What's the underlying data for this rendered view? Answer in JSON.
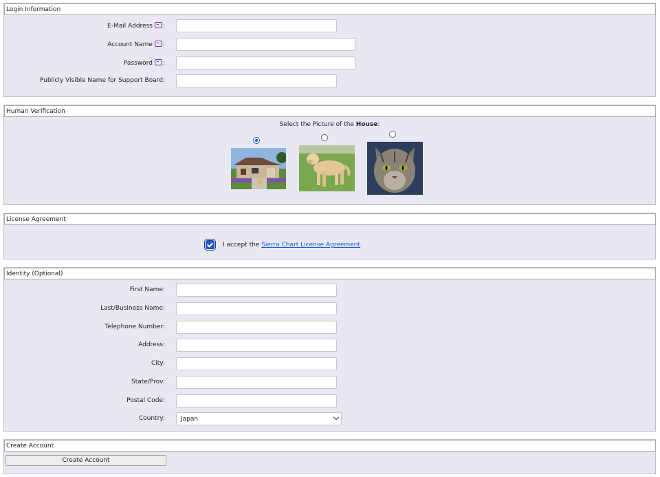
{
  "login": {
    "legend": "Login Information",
    "email_label": "E-Mail Address",
    "account_label": "Account Name",
    "password_label": "Password",
    "public_name_label": "Publicly Visible Name for Support Board:",
    "colon": ":",
    "email_value": "",
    "account_value": "",
    "password_value": "",
    "public_name_value": ""
  },
  "verification": {
    "legend": "Human Verification",
    "prompt_prefix": "Select the Picture of the ",
    "prompt_bold": "House",
    "prompt_suffix": ":",
    "options": [
      "house",
      "dog",
      "cat"
    ],
    "selected": "house"
  },
  "license": {
    "legend": "License Agreement",
    "accept_prefix": "I accept the ",
    "link_text": "Sierra Chart License Agreement",
    "accept_suffix": ".",
    "checked": true
  },
  "identity": {
    "legend": "Identity (Optional)",
    "first_name_label": "First Name:",
    "last_name_label": "Last/Business Name:",
    "telephone_label": "Telephone Number:",
    "address_label": "Address:",
    "city_label": "City:",
    "state_label": "State/Prov:",
    "postal_label": "Postal Code:",
    "country_label": "Country:",
    "country_value": "Japan"
  },
  "create": {
    "legend": "Create Account",
    "button_label": "Create Account"
  },
  "colors": {
    "section_bg": "#e8e8f2",
    "accent": "#1a5bd4",
    "info_icon": "#7b2f9a"
  }
}
